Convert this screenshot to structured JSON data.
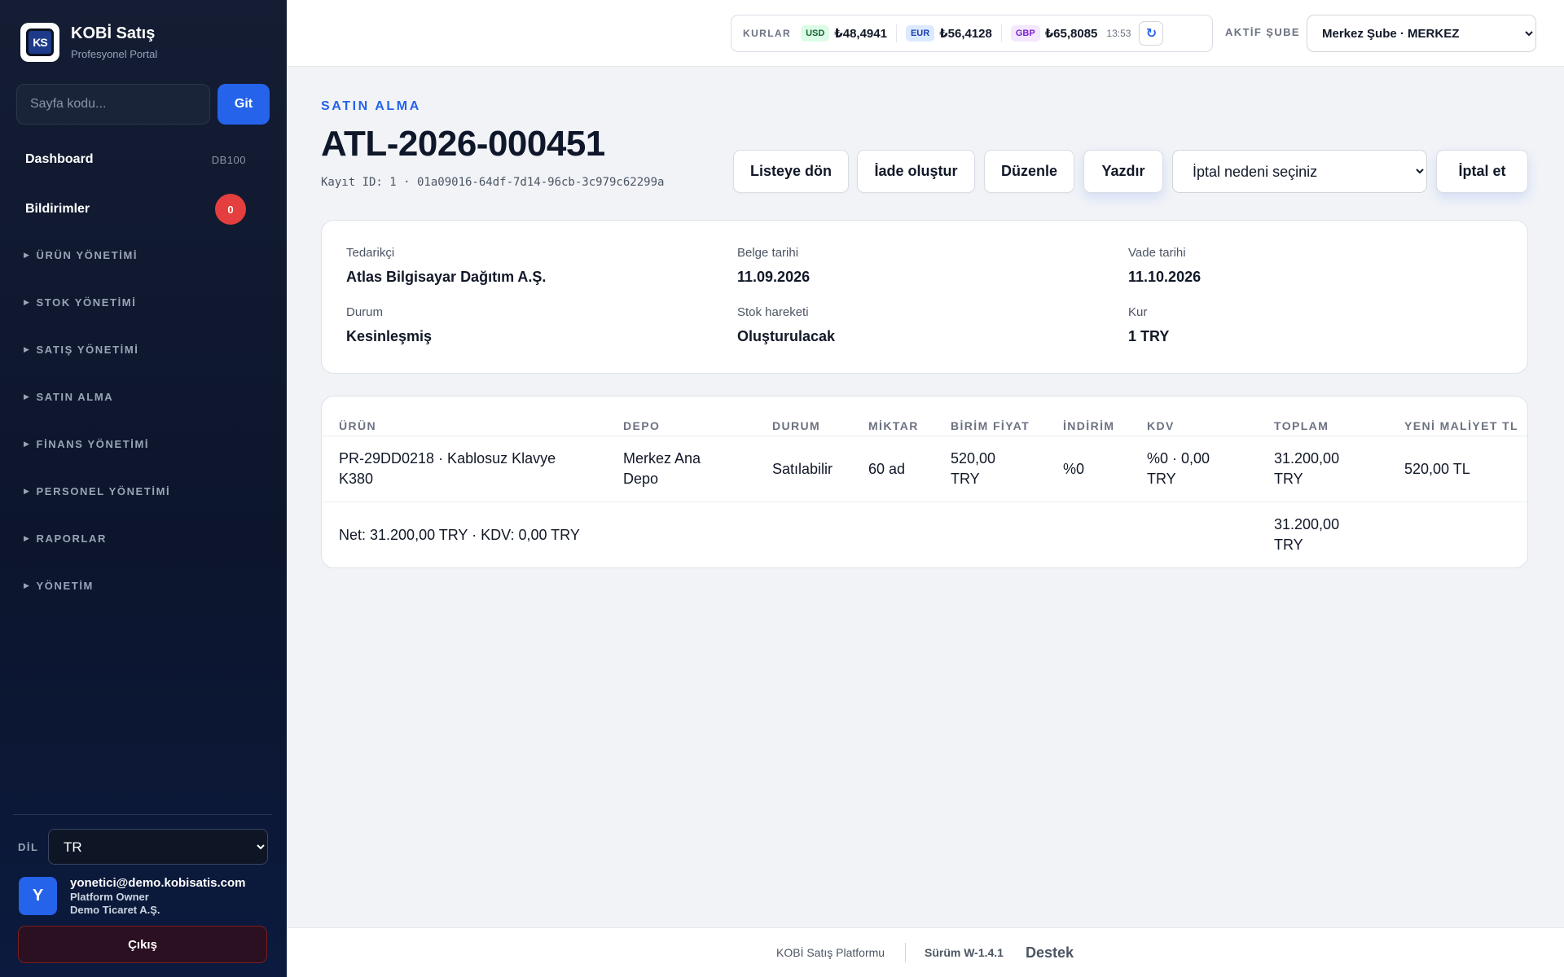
{
  "brand": {
    "logo_text": "KS",
    "title": "KOBİ Satış",
    "subtitle": "Profesyonel Portal"
  },
  "page_code": {
    "placeholder": "Sayfa kodu...",
    "button": "Git"
  },
  "sidebar": {
    "dashboard": {
      "label": "Dashboard",
      "code": "DB100"
    },
    "notifications": {
      "label": "Bildirimler",
      "count": "0"
    },
    "sections": [
      "ÜRÜN YÖNETİMİ",
      "STOK YÖNETİMİ",
      "SATIŞ YÖNETİMİ",
      "SATIN ALMA",
      "FİNANS YÖNETİMİ",
      "PERSONEL YÖNETİMİ",
      "RAPORLAR",
      "YÖNETİM"
    ],
    "language": {
      "label": "DİL",
      "value": "TR"
    },
    "user": {
      "initial": "Y",
      "email": "yonetici@demo.kobisatis.com",
      "role": "Platform Owner",
      "company": "Demo Ticaret A.Ş."
    },
    "logout": "Çıkış"
  },
  "topbar": {
    "rates_label": "KURLAR",
    "rates": [
      {
        "code": "USD",
        "value": "₺48,4941"
      },
      {
        "code": "EUR",
        "value": "₺56,4128"
      },
      {
        "code": "GBP",
        "value": "₺65,8085"
      }
    ],
    "rates_time": "13:53",
    "refresh_icon": "refresh-icon",
    "branch_label": "AKTİF ŞUBE",
    "branch_value": "Merkez Şube · MERKEZ"
  },
  "document": {
    "eyebrow": "SATIN ALMA",
    "title": "ATL-2026-000451",
    "record_id": "Kayıt ID: 1 · 01a09016-64df-7d14-96cb-3c979c62299a",
    "actions": {
      "back": "Listeye dön",
      "return": "İade oluştur",
      "edit": "Düzenle",
      "print": "Yazdır",
      "cancel_reason_placeholder": "İptal nedeni seçiniz",
      "cancel": "İptal et"
    },
    "fields": {
      "supplier": {
        "label": "Tedarikçi",
        "value": "Atlas Bilgisayar Dağıtım A.Ş."
      },
      "doc_date": {
        "label": "Belge tarihi",
        "value": "11.09.2026"
      },
      "due_date": {
        "label": "Vade tarihi",
        "value": "11.10.2026"
      },
      "status": {
        "label": "Durum",
        "value": "Kesinleşmiş"
      },
      "stock_move": {
        "label": "Stok hareketi",
        "value": "Oluşturulacak"
      },
      "rate": {
        "label": "Kur",
        "value": "1 TRY"
      }
    }
  },
  "table": {
    "headers": [
      "ÜRÜN",
      "DEPO",
      "DURUM",
      "MİKTAR",
      "BİRİM FİYAT",
      "İNDİRİM",
      "KDV",
      "TOPLAM",
      "YENİ MALİYET TL"
    ],
    "rows": [
      {
        "product": "PR-29DD0218 · Kablosuz Klavye K380",
        "warehouse": "Merkez Ana Depo",
        "status": "Satılabilir",
        "quantity": "60 ad",
        "unit_price": "520,00 TRY",
        "discount": "%0",
        "vat": "%0 · 0,00 TRY",
        "total": "31.200,00 TRY",
        "new_cost": "520,00 TL"
      }
    ],
    "summary": {
      "text": "Net: 31.200,00 TRY · KDV: 0,00 TRY",
      "total": "31.200,00 TRY"
    }
  },
  "footer": {
    "platform": "KOBİ Satış Platformu",
    "version": "Sürüm W-1.4.1",
    "support": "Destek"
  }
}
